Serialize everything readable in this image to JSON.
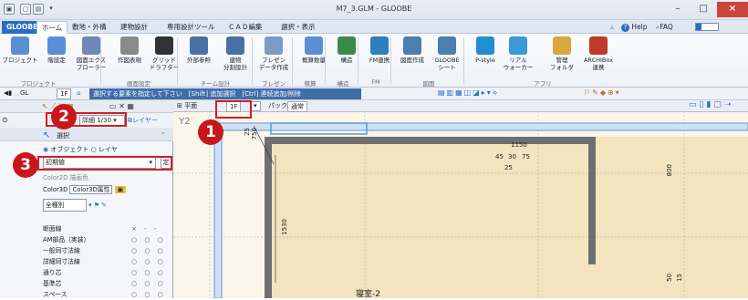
{
  "window": {
    "title": "M7_3.GLM - GLOOBE",
    "minimize": "–",
    "maximize": "□",
    "close": "×"
  },
  "quick_access": [
    "▣",
    "▢",
    "▤",
    "▾"
  ],
  "help": {
    "label": "Help",
    "faq": "FAQ"
  },
  "tabs": [
    "GLOOBE",
    "ホーム",
    "敷地・外構",
    "建物設計",
    "専用設計ツール",
    "ＣＡＤ編集",
    "選択・表示"
  ],
  "ribbon": {
    "buttons": [
      {
        "label": "プロジェクト",
        "color": "#5a8fd6"
      },
      {
        "label": "階設定",
        "color": "#5a8fd6"
      },
      {
        "label": "図面エクス\nプローラー",
        "color": "#6d88b5"
      },
      {
        "label": "作図表現",
        "color": "#8a8a8a"
      },
      {
        "label": "グリッド\nドラフター",
        "color": "#333333"
      },
      {
        "label": "外部参照",
        "color": "#4a6fa5"
      },
      {
        "label": "建物\n分割設計",
        "color": "#4a6fa5"
      },
      {
        "label": "プレゼン\nデータ作成",
        "color": "#7a9bc4"
      },
      {
        "label": "概算数量",
        "color": "#5a8fd6"
      },
      {
        "label": "構造",
        "color": "#3a8a4a"
      },
      {
        "label": "FM連携",
        "color": "#2d7fbf"
      },
      {
        "label": "図面作成",
        "color": "#4a7fb0"
      },
      {
        "label": "GLOOBE\nシート",
        "color": "#4a7fb0"
      },
      {
        "label": "P-style",
        "color": "#1f8fd1"
      },
      {
        "label": "リアル\nウォーカー",
        "color": "#3a9ad9"
      },
      {
        "label": "管理\nフォルダ",
        "color": "#d9a73a"
      },
      {
        "label": "ARCHIBox\n連携",
        "color": "#c0392b"
      }
    ],
    "groups": [
      "プロジェクト",
      "画面設定",
      "チーム設計",
      "プレゼン",
      "積算",
      "構造",
      "FM",
      "図面",
      "アプリ"
    ]
  },
  "command_bar": {
    "floor": "GL",
    "floor2": "1F",
    "hint": "選択する要素を指定して下さい　[Shift] 追加選択　[Ctrl] 連続追加/削除",
    "view_title": "平面",
    "floor_tab": "1F",
    "pack": "パック",
    "mode": "通常"
  },
  "panel": {
    "scale_label": "詳細 1/30",
    "layer_label": "レイヤー",
    "select_label": "選択",
    "object_label": "オブジェクト",
    "layer_radio": "レイヤ",
    "preset_value": "初期値",
    "preset_button": "定",
    "color2d_label": "Color2D",
    "color2d_value": "描画色",
    "color3d_label": "Color3D",
    "color3d_value": "Color3D属性",
    "all_types": "全種別",
    "rows": [
      "断面線",
      "AM部品（実装）",
      "一般同寸法線",
      "詳細同寸法線",
      "通り芯",
      "基準芯",
      "スペース"
    ],
    "row_state": "○ ○ ○",
    "row0_state": "× ‐ ‐"
  },
  "drawing": {
    "room_label": "寝室-2",
    "dims": [
      "1150",
      "45",
      "30",
      "75",
      "25",
      "800",
      "1530",
      "25",
      "750",
      "50",
      "15"
    ],
    "y_label": "Y2"
  },
  "callouts": [
    "1",
    "2",
    "3"
  ],
  "colors": {
    "accent": "#2b6cc4",
    "callout": "#c8161d",
    "highlight": "#d61c22",
    "canvas": "#f3e3bf",
    "wall": "#5b9bd5"
  }
}
